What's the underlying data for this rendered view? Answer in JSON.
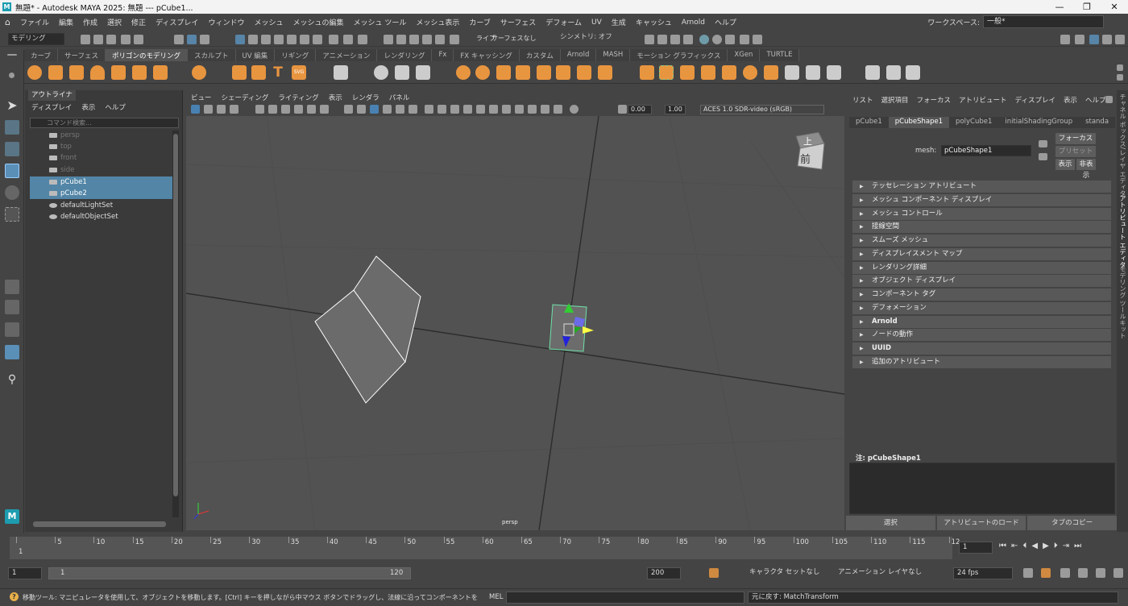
{
  "title_bar": {
    "title": "無題* - Autodesk MAYA 2025: 無題   ---   pCube1...",
    "controls": [
      "—",
      "❐",
      "✕"
    ]
  },
  "menu": {
    "items": [
      "ファイル",
      "編集",
      "作成",
      "選択",
      "修正",
      "ディスプレイ",
      "ウィンドウ",
      "メッシュ",
      "メッシュの編集",
      "メッシュ ツール",
      "メッシュ表示",
      "カーブ",
      "サーフェス",
      "デフォーム",
      "UV",
      "生成",
      "キャッシュ",
      "Arnold",
      "ヘルプ"
    ]
  },
  "workspace": {
    "label": "ワークスペース:",
    "value": "一般*"
  },
  "status_line": {
    "mode": "モデリング",
    "live": "ライブ",
    "live_value": "サーフェスなし",
    "symmetry": "シンメトリ: オフ"
  },
  "shelf": {
    "tabs": [
      "カーブ",
      "サーフェス",
      "ポリゴンのモデリング",
      "スカルプト",
      "UV 編集",
      "リギング",
      "アニメーション",
      "レンダリング",
      "Fx",
      "FX キャッシング",
      "カスタム",
      "Arnold",
      "MASH",
      "モーション グラフィックス",
      "XGen",
      "TURTLE"
    ],
    "active_tab": 2
  },
  "outliner": {
    "tab": "アウトライナ",
    "menus": [
      "ディスプレイ",
      "表示",
      "ヘルプ"
    ],
    "search_placeholder": "コマンド検索...",
    "items": [
      {
        "label": "persp",
        "dim": true,
        "selected": false
      },
      {
        "label": "top",
        "dim": true,
        "selected": false
      },
      {
        "label": "front",
        "dim": true,
        "selected": false
      },
      {
        "label": "side",
        "dim": true,
        "selected": false
      },
      {
        "label": "pCube1",
        "dim": false,
        "selected": true
      },
      {
        "label": "pCube2",
        "dim": false,
        "selected": true
      },
      {
        "label": "defaultLightSet",
        "dim": false,
        "selected": false
      },
      {
        "label": "defaultObjectSet",
        "dim": false,
        "selected": false
      }
    ]
  },
  "viewport": {
    "menus": [
      "ビュー",
      "シェーディング",
      "ライティング",
      "表示",
      "レンダラ",
      "パネル"
    ],
    "exposure": "0.00",
    "gamma": "1.00",
    "color_space": "ACES 1.0 SDR-video (sRGB)",
    "camera_label": "persp",
    "viewcube_top": "上",
    "viewcube_front": "前"
  },
  "attribute_editor": {
    "menus": [
      "リスト",
      "選択項目",
      "フォーカス",
      "アトリビュート",
      "ディスプレイ",
      "表示",
      "ヘルプ"
    ],
    "tabs": [
      "pCube1",
      "pCubeShape1",
      "polyCube1",
      "initialShadingGroup",
      "standa"
    ],
    "active_tab": 1,
    "mesh_label": "mesh:",
    "mesh_value": "pCubeShape1",
    "focus_btn": "フォーカス",
    "preset_btn": "プリセット",
    "show_btn": "表示",
    "hide_btn": "非表示",
    "sections": [
      "テッセレーション アトリビュート",
      "メッシュ コンポーネント ディスプレイ",
      "メッシュ コントロール",
      "接線空間",
      "スムーズ メッシュ",
      "ディスプレイスメント マップ",
      "レンダリング詳細",
      "オブジェクト ディスプレイ",
      "コンポーネント タグ",
      "デフォメーション",
      "Arnold",
      "ノードの動作",
      "UUID",
      "追加のアトリビュート"
    ],
    "notes_label": "注:  pCubeShape1",
    "bottom_buttons": [
      "選択",
      "アトリビュートのロード",
      "タブのコピー"
    ]
  },
  "side_tabs": [
    "チャネル ボックス/レイヤ エディタ",
    "アトリビュート エディタ",
    "モデリング ツールキット"
  ],
  "timeline": {
    "ticks": [
      "1",
      "5",
      "10",
      "15",
      "20",
      "25",
      "30",
      "35",
      "40",
      "45",
      "50",
      "55",
      "60",
      "65",
      "70",
      "75",
      "80",
      "85",
      "90",
      "95",
      "100",
      "105",
      "110",
      "115",
      "12"
    ],
    "current_frame": "1"
  },
  "range": {
    "start": "1",
    "range_start": "1",
    "range_end": "120",
    "end": "200",
    "char_set": "キャラクタ セットなし",
    "anim_layer": "アニメーション レイヤなし",
    "fps": "24 fps"
  },
  "command_line": {
    "help": "移動ツール: マニピュレータを使用して、オブジェクトを移動します。[Ctrl] キーを押しながら中マウス ボタンでドラッグし、法線に沿ってコンポーネントを移動します。[Shift] キーを押しながらマニ",
    "lang": "MEL",
    "result": "元に戻す: MatchTransform"
  },
  "logo_text": "M"
}
